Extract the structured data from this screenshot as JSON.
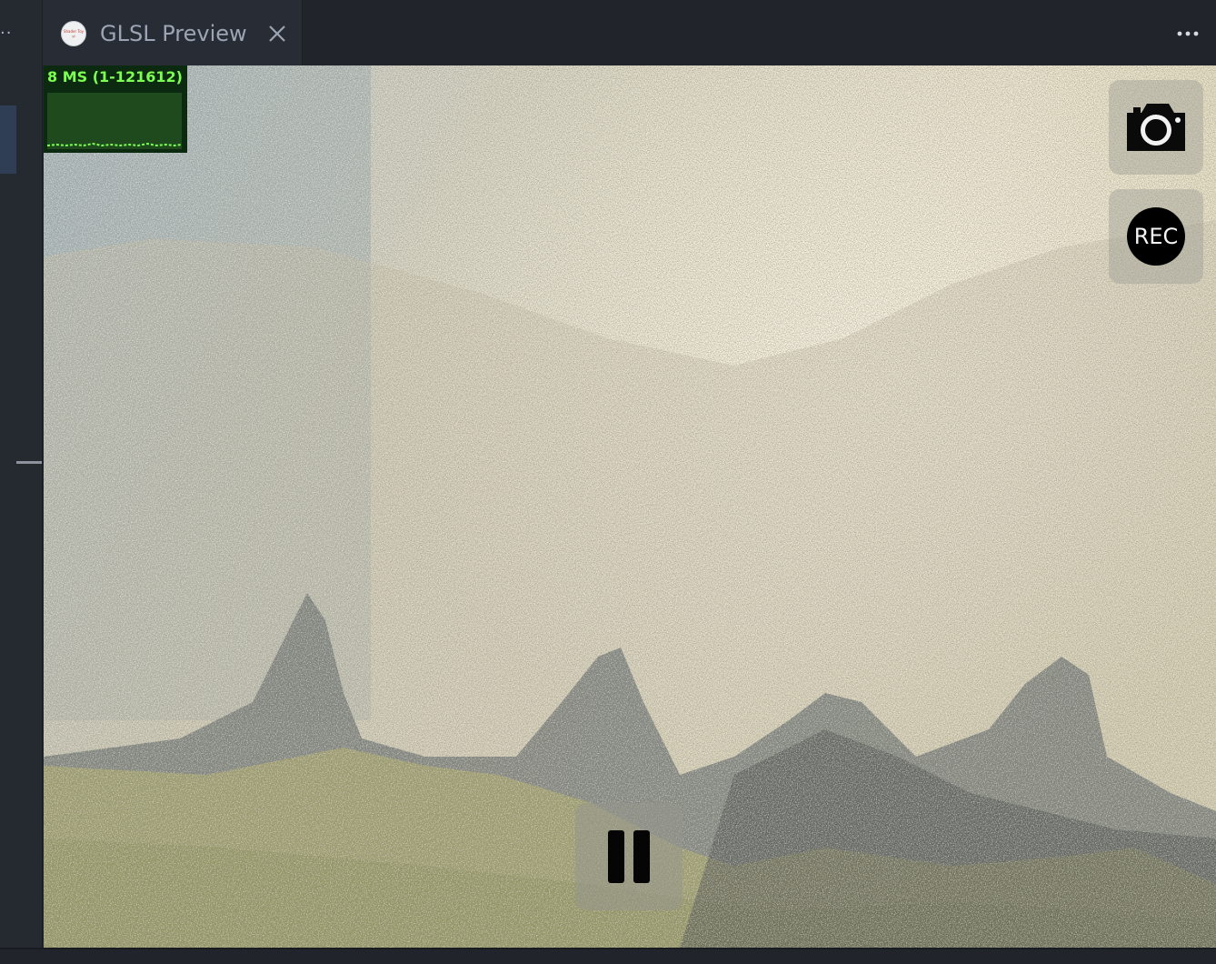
{
  "tab": {
    "title": "GLSL Preview",
    "icon": "shadertoy-logo-icon",
    "close_icon": "close-icon"
  },
  "toolbar": {
    "more_icon": "ellipsis-icon"
  },
  "stats": {
    "label": "8 MS (1-121612)",
    "color": "#7cff52"
  },
  "controls": {
    "snapshot_icon": "camera-icon",
    "record_label": "REC",
    "pause_icon": "pause-icon"
  },
  "colors": {
    "editor_background": "#21252b",
    "tab_active": "#282c34",
    "tab_text": "#9da5b4"
  }
}
